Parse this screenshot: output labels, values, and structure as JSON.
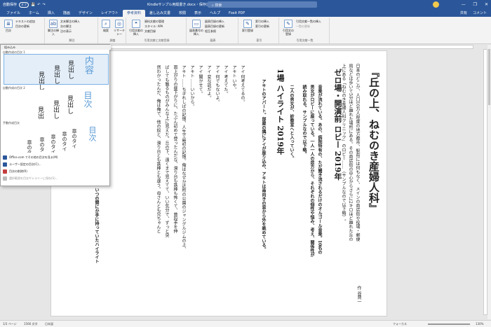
{
  "titlebar": {
    "autosave": "自動保存",
    "autosave_state": "オフ",
    "doc_title": "Kindleサンプル用縦書き.docx・保存済み",
    "search_placeholder": "検索",
    "user_initial": "",
    "min": "—",
    "max": "❐",
    "close": "✕"
  },
  "tabs": [
    "ファイル",
    "ホーム",
    "挿入",
    "描画",
    "デザイン",
    "レイアウト",
    "参考資料",
    "差し込み文書",
    "校閲",
    "表示",
    "ヘルプ",
    "Foxit PDF"
  ],
  "tabs_right": {
    "share": "共有",
    "comment": "コメント"
  },
  "ribbon": {
    "toc_btn": "目次",
    "add_text": "テキストの追加",
    "update_toc": "目次の更新",
    "footnote_btn": "脚注の挿入",
    "insert_endnote": "文末脚注の挿入",
    "next_footnote": "次の脚注",
    "show_notes": "注の表示",
    "search_btn": "検索",
    "researcher_btn": "リサーチャー",
    "citation_btn": "引用文献の挿入",
    "manage_sources": "資料文献の管理",
    "style_label": "スタイル: APA",
    "bibliography": "文献目録",
    "caption_btn": "図表番号の挿入",
    "table_of_figures": "図表目録の挿入",
    "update_table": "図表目録の更新",
    "cross_ref": "相互参照",
    "mark_entry_btn": "索引登録",
    "insert_index": "索引の挿入",
    "update_index": "索引の更新",
    "mark_citation_btn": "引用文の登録",
    "insert_toa": "引用文献一覧の挿入",
    "update_toa": "一覧の更新",
    "grp_footnotes": "脚注",
    "grp_research": "調査",
    "grp_citations": "引用文献と文献目録",
    "grp_captions": "図表",
    "grp_index": "索引",
    "grp_toa": "引用文献一覧"
  },
  "panel": {
    "header": "組み込み",
    "sec1": "自動作成の目次 1",
    "sec2": "自動作成の目次 2",
    "sec3": "手動作成目次",
    "toc1_title": "内容",
    "toc2_title": "目次",
    "toc3_title": "目次",
    "heading": "見出し",
    "chapter": "章のタイ",
    "menu": [
      "Office.com でその他の目次を見る(M)",
      "ユーザー設定の目次(C)...",
      "目次の削除(R)",
      "選択範囲を目次ギャラリーに保存(S)..."
    ]
  },
  "doc": {
    "title": "『丘の上、ねむのき産婦人科』",
    "author": "作 谷賢一",
    "intro": [
      "日本のどこか、人口10万人程度の地方都市、駅前には何もなく、メインの商店街や役場・郵便",
      "局などは歩いて5分ほど離れた場所にある。その商店街の中心からさらに2キロほど離れた丘の",
      "上にある「ねむのき産婦人科クリニック」のロビー……（サンプルなので以下略）。"
    ],
    "scene0": "ゼロ場・開演前 ロビー 2019年",
    "scene0_text": [
      "音楽が流れている。あの、病院特有の、ただ聞き流されるだけのオルゴール音楽。10名の",
      "男女がロビーに座っている。一人一人の居方から、それぞれの個性や悩み、考え、関係性が",
      "読み取れる。サンプルなので以下略。",
      "二人の男女が、診察室へと入っていく。"
    ],
    "scene1": "1場 ハイライト 2019年",
    "scene1_text": "アキトのアパート。部屋の隅にアイが座り込み、アキトは南向きの窓から外を眺めている。",
    "lines": [
      "アイ 何考えてるの。",
      "アキト いや。",
      "アイ 考えてた。",
      "アイ 何でもないよ。",
      "アイ 変な話だよ。",
      "アイ 聞かせて。",
      "アキト ……いいから。",
      "アキト ……ちぎれしばの記憶、人生で最初の記憶。俺はなぜか近所の公園のジャングルジムの上、",
      "雨上がりの昼下がりに、たぶん初めて登ったんだな、滑り台も鉄棒も怖くて、普段手を伸",
      "ばしても触るものがみんな上に見えた。丘の下、遠くまで見えてて、いい気分で、ずっと突",
      "然わかったんだ、俺は俺で、他の奴と、滑り台とも鉄棒とも違う。母さんとも兄ちゃんと",
      "いつの間にか手に持っていたハイライト"
    ]
  },
  "status": {
    "page": "1/3 ページ",
    "words": "1566 文字",
    "lang": "日本語",
    "focus": "フォーカス",
    "zoom": "130%"
  }
}
